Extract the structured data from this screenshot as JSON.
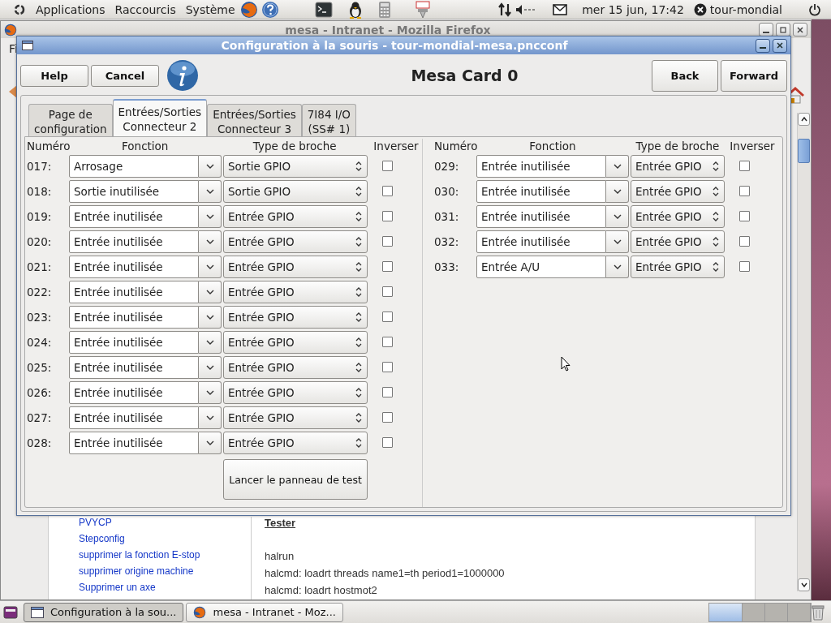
{
  "top_panel": {
    "menus": [
      "Applications",
      "Raccourcis",
      "Système"
    ],
    "clock": "mer 15 jun, 17:42",
    "user": "tour-mondial"
  },
  "browser": {
    "title": "mesa - Intranet - Mozilla Firefox",
    "menu_fragment": "Fi",
    "links": [
      "PVYCP",
      "Stepconfig",
      "supprimer la fonction E-stop",
      "supprimer origine machine",
      "Supprimer un axe"
    ],
    "heading": "Tester",
    "lines": [
      "halrun",
      "halcmd: loadrt threads name1=th period1=1000000",
      "halcmd: loadrt hostmot2"
    ]
  },
  "dialog": {
    "title": "Configuration à la souris - tour-mondial-mesa.pncconf",
    "left_buttons": [
      "Help",
      "Cancel"
    ],
    "heading": "Mesa Card 0",
    "right_buttons": [
      "Back",
      "Forward"
    ],
    "tabs": [
      {
        "label": "Page de\nconfiguration",
        "selected": false
      },
      {
        "label": "Entrées/Sorties\nConnecteur 2",
        "selected": true
      },
      {
        "label": "Entrées/Sorties\nConnecteur 3",
        "selected": false
      },
      {
        "label": "7I84 I/O\n(SS# 1)",
        "selected": false
      }
    ],
    "columns": [
      "Numéro",
      "Fonction",
      "Type de broche",
      "Inverser"
    ],
    "left_pins": [
      {
        "number": "017:",
        "function": "Arrosage",
        "type": "Sortie GPIO",
        "inverted": false
      },
      {
        "number": "018:",
        "function": "Sortie inutilisée",
        "type": "Sortie GPIO",
        "inverted": false
      },
      {
        "number": "019:",
        "function": "Entrée inutilisée",
        "type": "Entrée GPIO",
        "inverted": false
      },
      {
        "number": "020:",
        "function": "Entrée inutilisée",
        "type": "Entrée GPIO",
        "inverted": false
      },
      {
        "number": "021:",
        "function": "Entrée inutilisée",
        "type": "Entrée GPIO",
        "inverted": false
      },
      {
        "number": "022:",
        "function": "Entrée inutilisée",
        "type": "Entrée GPIO",
        "inverted": false
      },
      {
        "number": "023:",
        "function": "Entrée inutilisée",
        "type": "Entrée GPIO",
        "inverted": false
      },
      {
        "number": "024:",
        "function": "Entrée inutilisée",
        "type": "Entrée GPIO",
        "inverted": false
      },
      {
        "number": "025:",
        "function": "Entrée inutilisée",
        "type": "Entrée GPIO",
        "inverted": false
      },
      {
        "number": "026:",
        "function": "Entrée inutilisée",
        "type": "Entrée GPIO",
        "inverted": false
      },
      {
        "number": "027:",
        "function": "Entrée inutilisée",
        "type": "Entrée GPIO",
        "inverted": false
      },
      {
        "number": "028:",
        "function": "Entrée inutilisée",
        "type": "Entrée GPIO",
        "inverted": false
      }
    ],
    "right_columns": [
      "Numéro",
      "Fonction",
      "Type de broche",
      "Inverser"
    ],
    "right_pins": [
      {
        "number": "029:",
        "function": "Entrée inutilisée",
        "type": "Entrée GPIO",
        "inverted": false
      },
      {
        "number": "030:",
        "function": "Entrée inutilisée",
        "type": "Entrée GPIO",
        "inverted": false
      },
      {
        "number": "031:",
        "function": "Entrée inutilisée",
        "type": "Entrée GPIO",
        "inverted": false
      },
      {
        "number": "032:",
        "function": "Entrée inutilisée",
        "type": "Entrée GPIO",
        "inverted": false
      },
      {
        "number": "033:",
        "function": "Entrée A/U",
        "type": "Entrée GPIO",
        "inverted": false
      }
    ],
    "test_button": "Lancer le panneau de test"
  },
  "taskbar": {
    "tasks": [
      {
        "label": "Configuration à la sou...",
        "kind": "dialog",
        "selected": true
      },
      {
        "label": "mesa - Intranet - Moz...",
        "kind": "browser",
        "selected": false
      }
    ]
  }
}
